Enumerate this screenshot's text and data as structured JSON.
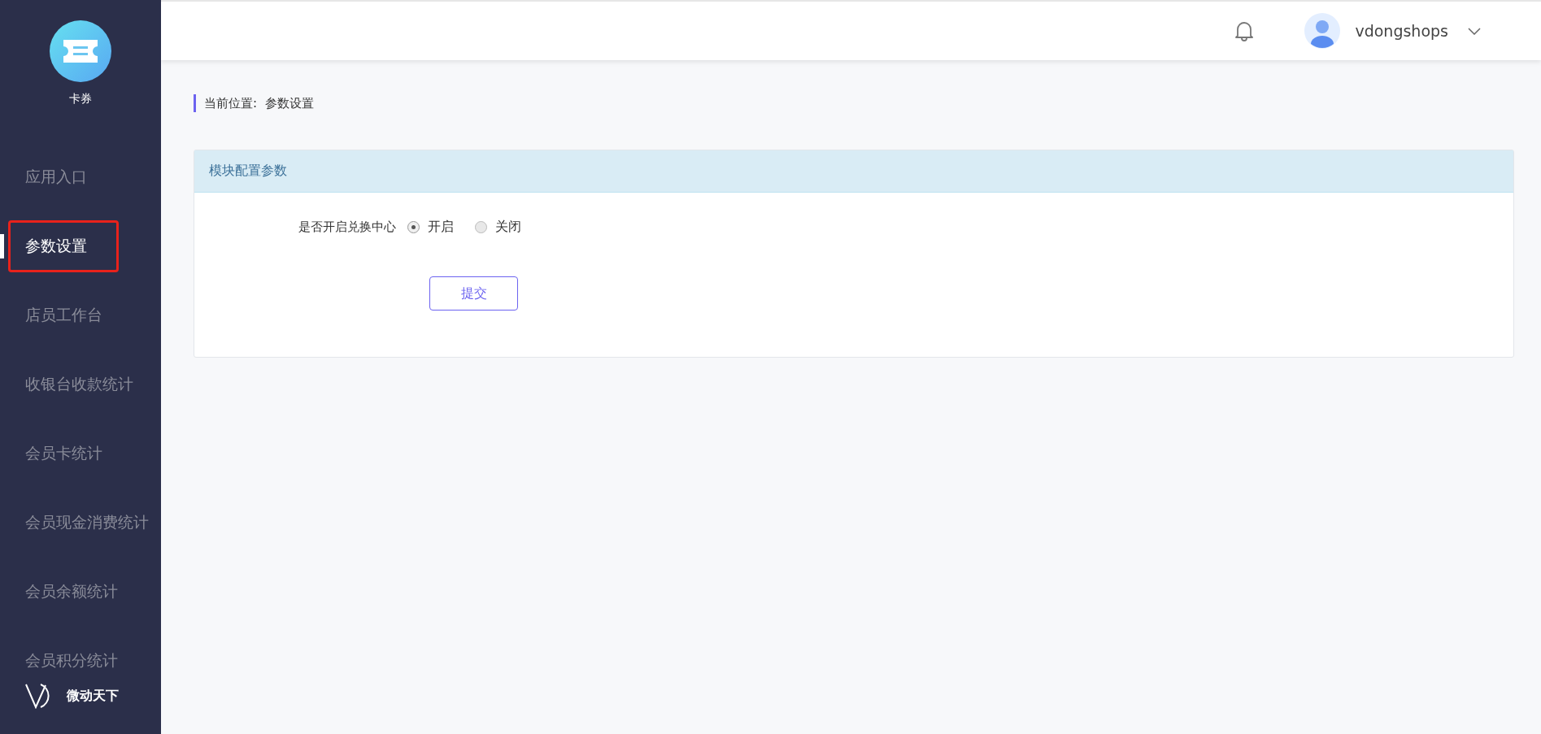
{
  "sidebar": {
    "app_name": "卡券",
    "items": [
      {
        "label": "应用入口",
        "selected": false,
        "highlighted": false
      },
      {
        "label": "参数设置",
        "selected": true,
        "highlighted": true
      },
      {
        "label": "店员工作台",
        "selected": false,
        "highlighted": false
      },
      {
        "label": "收银台收款统计",
        "selected": false,
        "highlighted": false
      },
      {
        "label": "会员卡统计",
        "selected": false,
        "highlighted": false
      },
      {
        "label": "会员现金消费统计",
        "selected": false,
        "highlighted": false
      },
      {
        "label": "会员余额统计",
        "selected": false,
        "highlighted": false
      },
      {
        "label": "会员积分统计",
        "selected": false,
        "highlighted": false
      }
    ],
    "brand": "微动天下"
  },
  "header": {
    "username": "vdongshops"
  },
  "breadcrumb": {
    "label": "当前位置:",
    "current": "参数设置"
  },
  "card": {
    "title": "模块配置参数",
    "field_label": "是否开启兑换中心",
    "options": [
      {
        "label": "开启",
        "selected": true
      },
      {
        "label": "关闭",
        "selected": false
      }
    ],
    "submit": "提交"
  }
}
